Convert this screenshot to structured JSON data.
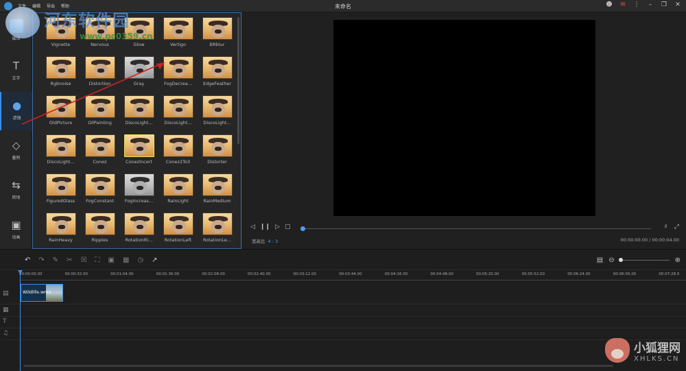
{
  "app": {
    "title": "未命名",
    "menu": [
      "文件",
      "编辑",
      "导出",
      "帮助"
    ]
  },
  "window_controls": [
    "user-icon",
    "message-icon",
    "more-icon",
    "minimize-icon",
    "restore-icon",
    "close-icon"
  ],
  "sidebar": {
    "items": [
      {
        "label": "媒体",
        "icon": "media-icon"
      },
      {
        "label": "文字",
        "icon": "text-icon"
      },
      {
        "label": "滤镜",
        "icon": "filter-icon",
        "active": true
      },
      {
        "label": "叠附",
        "icon": "overlay-icon"
      },
      {
        "label": "转场",
        "icon": "transition-icon"
      },
      {
        "label": "动画",
        "icon": "animation-icon"
      }
    ]
  },
  "filters": {
    "items": [
      "Vignette",
      "Nervous",
      "Glow",
      "Vertigo",
      "BRblur",
      "Rgbnoise",
      "Distortion",
      "Gray",
      "FogDecrea...",
      "EdgeFeather",
      "OldPicture",
      "OilPainting",
      "DiscoLight...",
      "DiscoLight...",
      "DiscoLight...",
      "DiscoLight...",
      "Conez",
      "ConezIncert",
      "Conez2To3",
      "Distorter",
      "FiguredGlass",
      "FogConstant",
      "FogIncreas...",
      "RainLight",
      "RainMedium",
      "RainHeavy",
      "Ripples",
      "RotationRi...",
      "RotationLeft",
      "RotationLe..."
    ]
  },
  "watermark": {
    "text": "河东软件园",
    "url": "www.pc0359.cn"
  },
  "preview": {
    "ratio_label": "宽高比",
    "ratio_value": "4 : 3",
    "time": "00:00:00.00 / 00:00:04.00",
    "progress": 0
  },
  "timeline": {
    "ticks": [
      "00:00:00.00",
      "00:00:32.00",
      "00:01:04.00",
      "00:01:36.00",
      "00:02:08.00",
      "00:02:40.00",
      "00:03:12.00",
      "00:03:44.00",
      "00:04:16.00",
      "00:04:48.00",
      "00:05:20.00",
      "00:05:52.00",
      "00:06:24.00",
      "00:06:56.00",
      "00:07:28.0"
    ],
    "clip_name": "Wildlife.wmv",
    "zoom": 0
  },
  "corner_logo": {
    "cn": "小狐狸网",
    "en": "XHLKS.CN"
  }
}
